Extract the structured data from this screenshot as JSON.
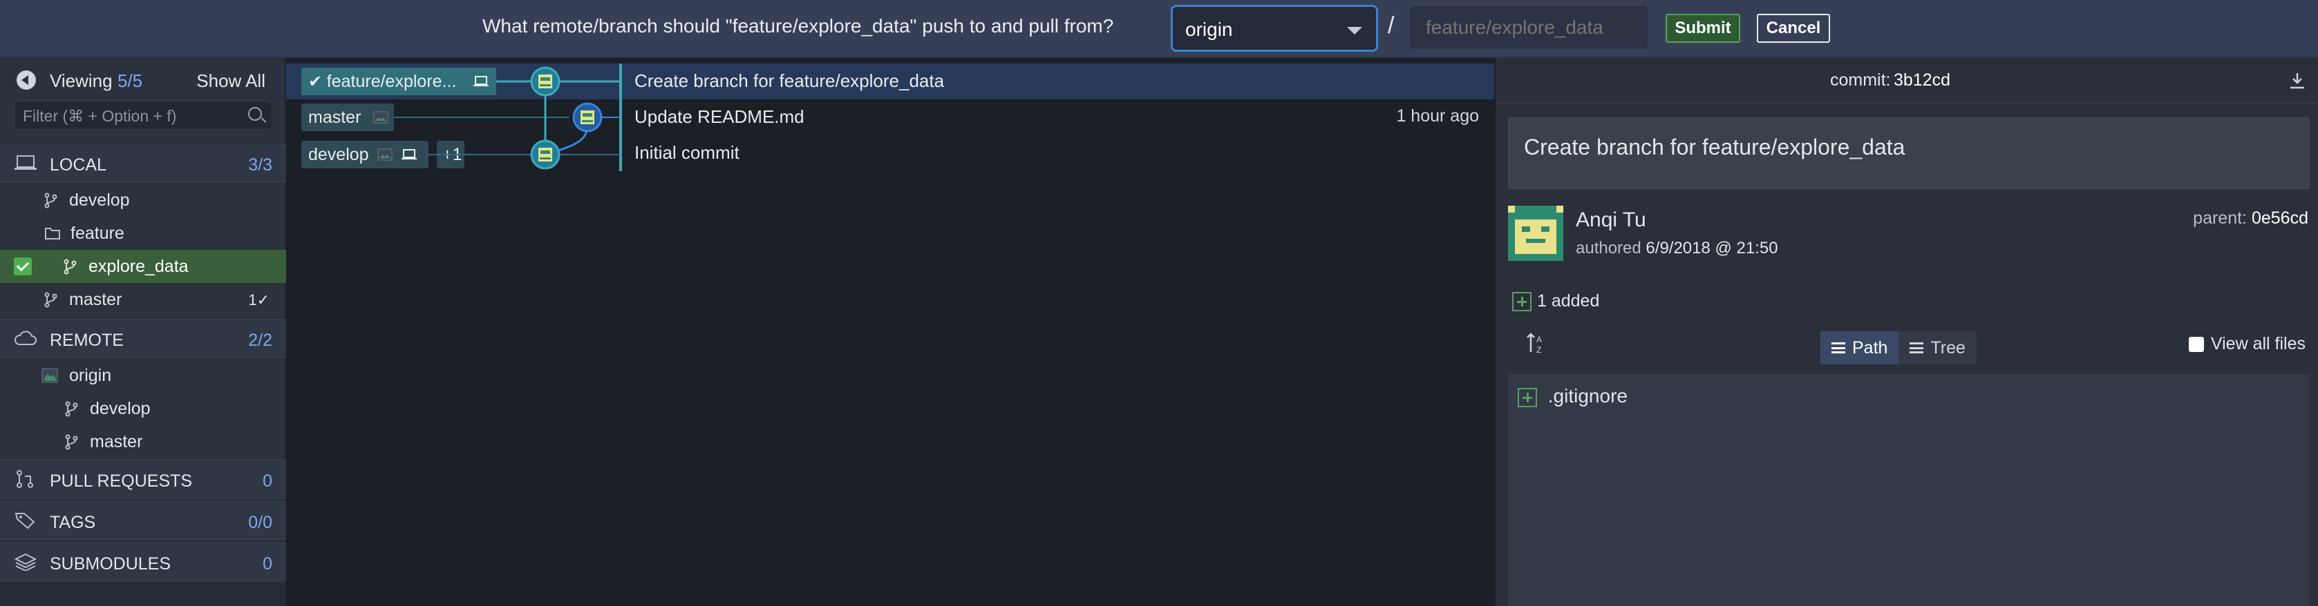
{
  "push_prompt": {
    "question": "What remote/branch should \"feature/explore_data\" push to and pull from?",
    "remote_value": "origin",
    "separator": "/",
    "branch_placeholder": "feature/explore_data",
    "submit_label": "Submit",
    "cancel_label": "Cancel"
  },
  "sidebar": {
    "viewing_label": "Viewing",
    "viewing_count": "5/5",
    "show_all": "Show All",
    "filter_placeholder": "Filter (⌘ + Option + f)",
    "local": {
      "label": "LOCAL",
      "count": "3/3",
      "items": [
        {
          "label": "develop",
          "icon": "branch-icon"
        },
        {
          "label": "feature",
          "icon": "folder-icon"
        },
        {
          "label": "explore_data",
          "icon": "branch-icon",
          "selected": true
        },
        {
          "label": "master",
          "icon": "branch-icon",
          "badge": "1✓"
        }
      ]
    },
    "remote": {
      "label": "REMOTE",
      "count": "2/2",
      "origin": "origin",
      "items": [
        {
          "label": "develop",
          "icon": "branch-icon"
        },
        {
          "label": "master",
          "icon": "branch-icon"
        }
      ]
    },
    "pull_requests": {
      "label": "PULL REQUESTS",
      "count": "0"
    },
    "tags": {
      "label": "TAGS",
      "count": "0/0"
    },
    "submodules": {
      "label": "SUBMODULES",
      "count": "0"
    }
  },
  "graph": {
    "rows": [
      {
        "ref": "feature/explore...",
        "message": "Create branch for feature/explore_data",
        "time": ""
      },
      {
        "ref": "master",
        "message": "Update README.md",
        "time": "1 hour ago"
      },
      {
        "ref": "develop",
        "extra": "+1",
        "message": "Initial commit",
        "time": ""
      }
    ]
  },
  "details": {
    "commit_label": "commit:",
    "commit_sha": "3b12cd",
    "summary": "Create branch for feature/explore_data",
    "author": "Anqi Tu",
    "authored_label": "authored",
    "authored_date": "6/9/2018 @ 21:50",
    "parent_label": "parent:",
    "parent_sha": "0e56cd",
    "added": "1 added",
    "path_label": "Path",
    "tree_label": "Tree",
    "view_all": "View all files",
    "files": [
      ".gitignore"
    ]
  },
  "colors": {
    "accent_blue": "#3b82d8",
    "graph_teal": "#41a9b8",
    "selected_row": "#26395a",
    "added_green": "#5aa05e",
    "avatar_green": "#2e8a6e"
  }
}
